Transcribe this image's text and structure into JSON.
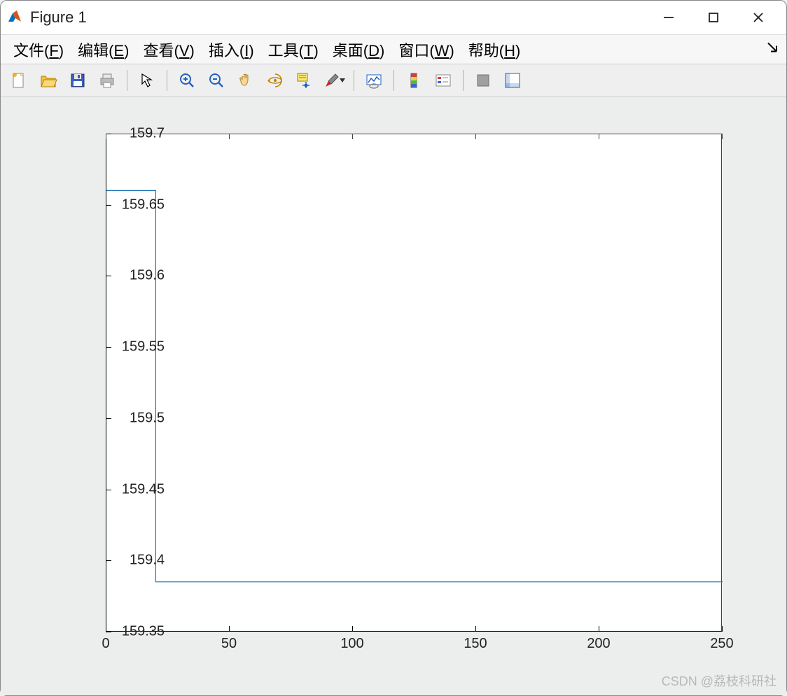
{
  "window": {
    "title": "Figure 1"
  },
  "menu": {
    "file": {
      "label": "文件",
      "mnemonic": "F"
    },
    "edit": {
      "label": "编辑",
      "mnemonic": "E"
    },
    "view": {
      "label": "查看",
      "mnemonic": "V"
    },
    "insert": {
      "label": "插入",
      "mnemonic": "I"
    },
    "tools": {
      "label": "工具",
      "mnemonic": "T"
    },
    "desktop": {
      "label": "桌面",
      "mnemonic": "D"
    },
    "window_menu": {
      "label": "窗口",
      "mnemonic": "W"
    },
    "help": {
      "label": "帮助",
      "mnemonic": "H"
    }
  },
  "toolbar": {
    "icons": {
      "new": "new-figure-icon",
      "open": "open-icon",
      "save": "save-icon",
      "print": "print-icon",
      "pointer": "pointer-icon",
      "zoom_in": "zoom-in-icon",
      "zoom_out": "zoom-out-icon",
      "pan": "pan-icon",
      "rotate": "rotate-3d-icon",
      "data_cursor": "data-cursor-icon",
      "brush": "brush-icon",
      "link": "link-plot-icon",
      "colorbar": "colorbar-icon",
      "legend": "legend-icon",
      "hide_tools": "hide-plot-tools-icon",
      "show_tools": "show-plot-tools-icon"
    }
  },
  "chart_data": {
    "type": "line",
    "x": [
      0,
      20,
      20,
      250
    ],
    "y": [
      159.66,
      159.66,
      159.385,
      159.385
    ],
    "xlim": [
      0,
      250
    ],
    "ylim": [
      159.35,
      159.7
    ],
    "xticks": [
      0,
      50,
      100,
      150,
      200,
      250
    ],
    "yticks": [
      159.35,
      159.4,
      159.45,
      159.5,
      159.55,
      159.6,
      159.65,
      159.7
    ],
    "ytick_labels": [
      "159.35",
      "159.4",
      "159.45",
      "159.5",
      "159.55",
      "159.6",
      "159.65",
      "159.7"
    ],
    "title": "",
    "xlabel": "",
    "ylabel": "",
    "line_color": "#1f77b4"
  },
  "watermark": "CSDN @荔枝科研社"
}
